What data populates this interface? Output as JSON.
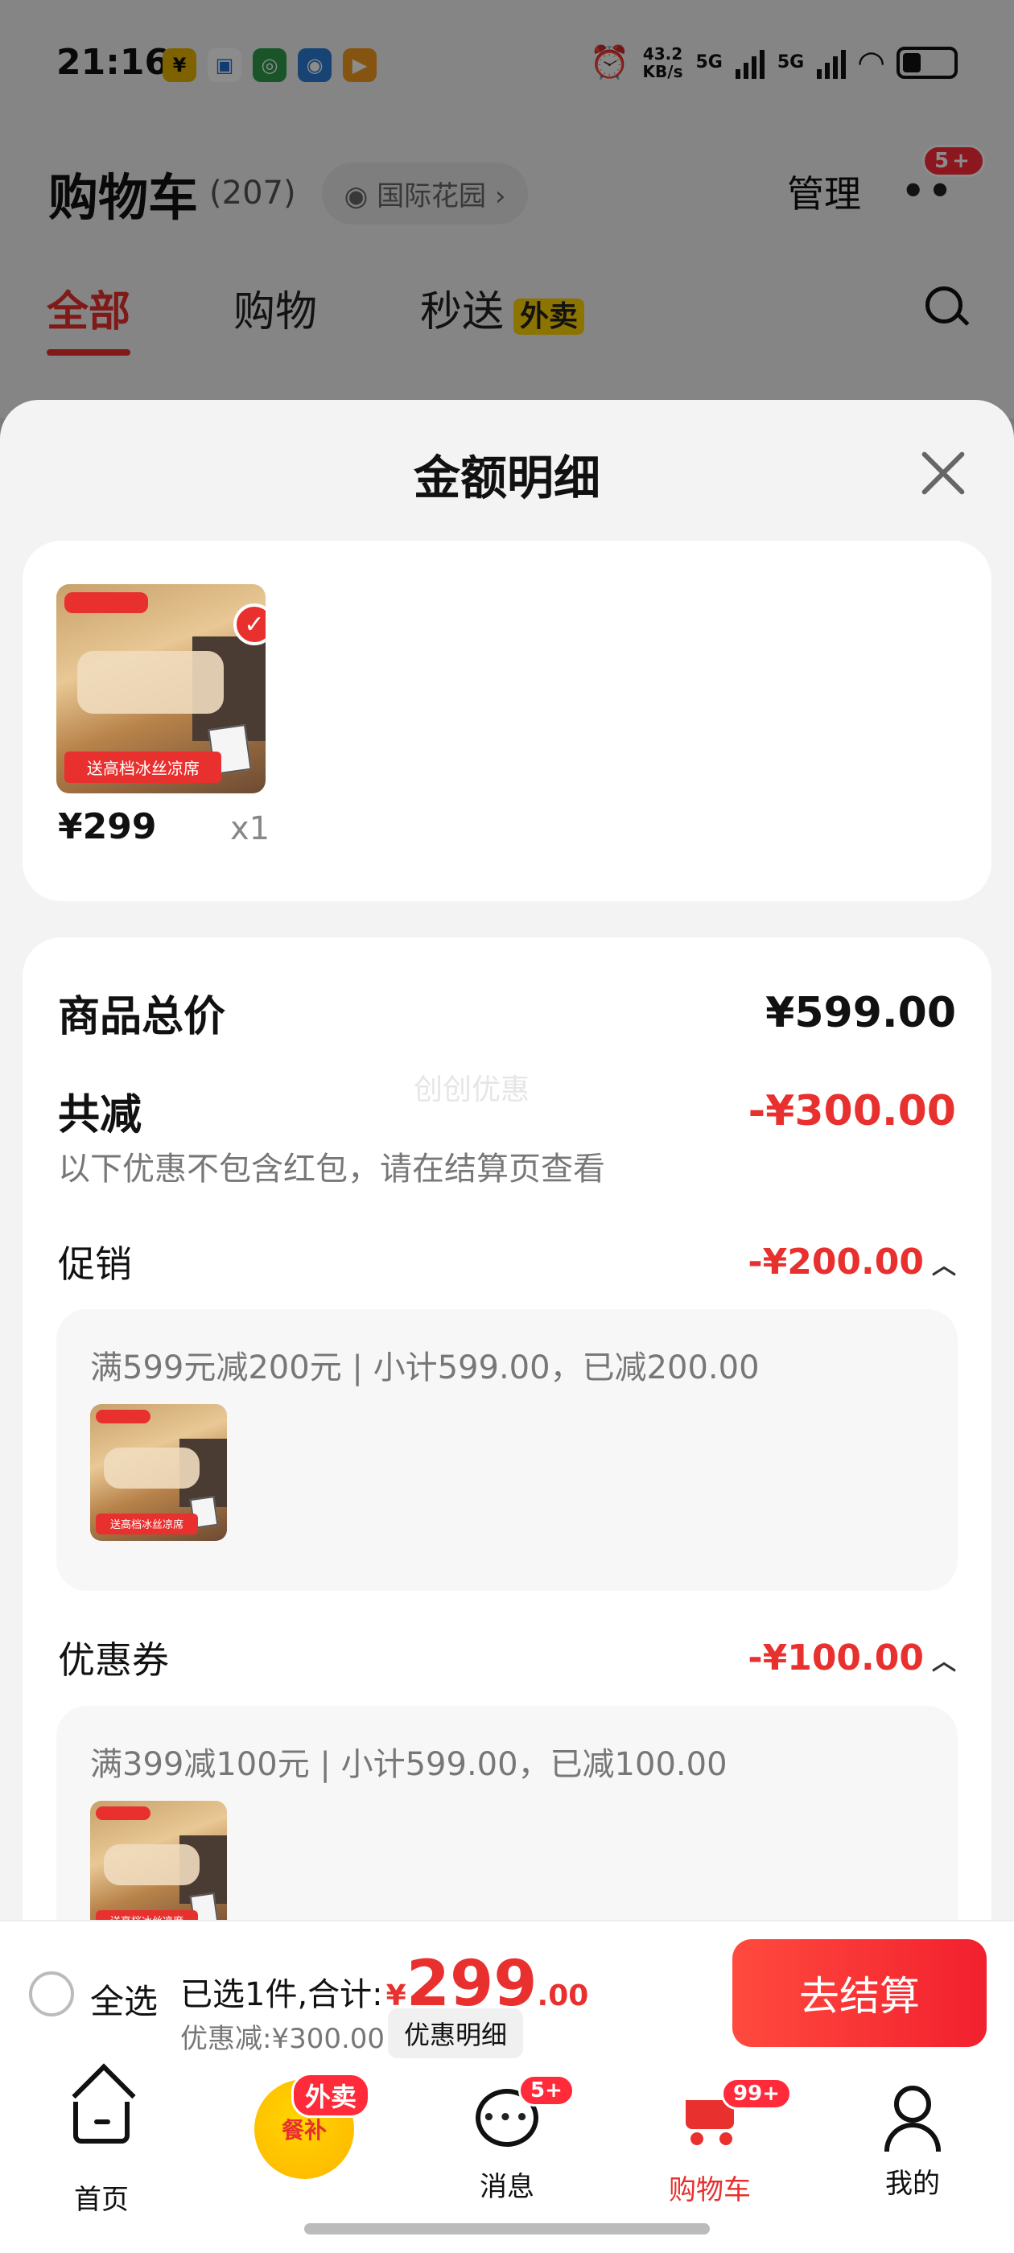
{
  "status_bar": {
    "time": "21:16",
    "net_speed_value": "43.2",
    "net_speed_unit": "KB/s",
    "sig1": "5G",
    "sig2": "5G",
    "app_icons": [
      "¥",
      "▣",
      "◎",
      "◉",
      "▶"
    ]
  },
  "background_page": {
    "title": "购物车",
    "count": "(207)",
    "location": "国际花园",
    "manage": "管理",
    "more_badge": "5+",
    "tabs": [
      "全部",
      "购物",
      "秒送"
    ],
    "waimai_tag": "外卖"
  },
  "sheet": {
    "title": "金额明细",
    "product": {
      "price": "¥299",
      "qty": "x1",
      "banner": "送高档冰丝凉席"
    },
    "summary": {
      "total_label": "商品总价",
      "total_value": "¥599.00",
      "reduce_label": "共减",
      "reduce_value": "-¥300.00",
      "reduce_note": "以下优惠不包含红包，请在结算页查看",
      "watermark": "创创优惠"
    },
    "promo": {
      "label": "促销",
      "value": "-¥200.00",
      "detail": "满599元减200元 | 小计599.00，已减200.00"
    },
    "coupon": {
      "label": "优惠券",
      "value": "-¥100.00",
      "detail": "满399减100元 | 小计599.00，已减100.00"
    }
  },
  "checkout": {
    "select_all": "全选",
    "selected_text": "已选1件,合计:",
    "currency": "¥",
    "total_int": "299",
    "total_dec": ".00",
    "discount": "优惠减:¥300.00",
    "detail_btn": "优惠明细",
    "pay_btn": "去结算"
  },
  "nav": {
    "home": "首页",
    "meal": "餐补",
    "meal_badge": "外卖",
    "messages": "消息",
    "messages_badge": "5+",
    "cart": "购物车",
    "cart_badge": "99+",
    "me": "我的"
  }
}
